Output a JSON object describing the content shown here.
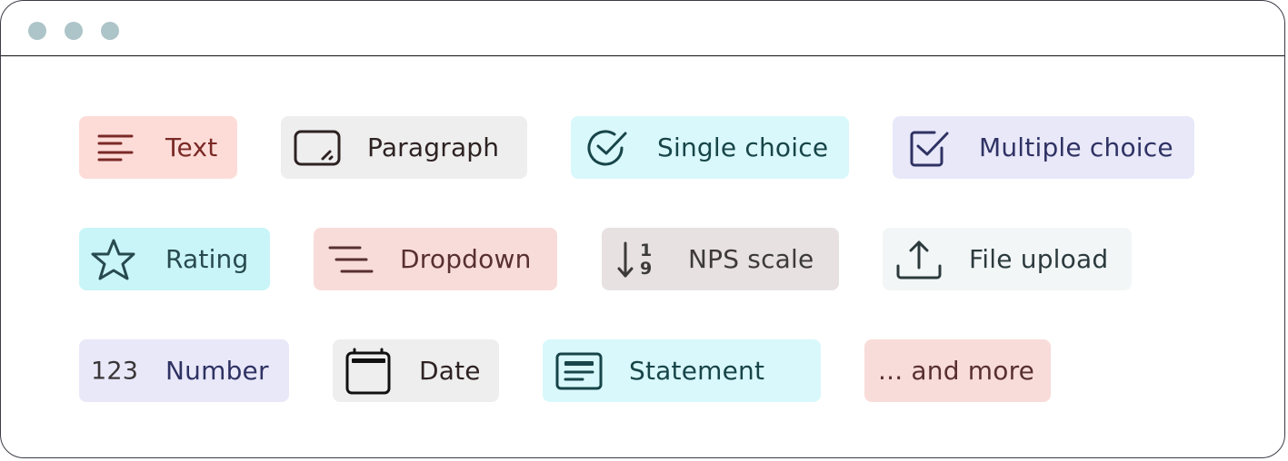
{
  "window": {
    "controls": [
      "dot-1",
      "dot-2",
      "dot-3"
    ],
    "control_color": "#adc4c8"
  },
  "field_types": [
    {
      "id": "text",
      "label": "Text",
      "icon": "text-lines-icon",
      "bg": "#fddcd8",
      "fg": "#7a2a26"
    },
    {
      "id": "paragraph",
      "label": "Paragraph",
      "icon": "paragraph-box-icon",
      "bg": "#eeeeee",
      "fg": "#2e2222"
    },
    {
      "id": "single-choice",
      "label": "Single choice",
      "icon": "circle-check-icon",
      "bg": "#d9f8fb",
      "fg": "#174549"
    },
    {
      "id": "multiple-choice",
      "label": "Multiple choice",
      "icon": "square-check-icon",
      "bg": "#e8e8f9",
      "fg": "#2f3263"
    },
    {
      "id": "rating",
      "label": "Rating",
      "icon": "star-icon",
      "bg": "#c9f5f8",
      "fg": "#284a4e"
    },
    {
      "id": "dropdown",
      "label": "Dropdown",
      "icon": "dropdown-lines-icon",
      "bg": "#f8dcd9",
      "fg": "#583031"
    },
    {
      "id": "nps-scale",
      "label": "NPS scale",
      "icon": "sort-numeric-icon",
      "icon_text_top": "1",
      "icon_text_bottom": "9",
      "bg": "#e7e1e1",
      "fg": "#3d3a3a"
    },
    {
      "id": "file-upload",
      "label": "File upload",
      "icon": "upload-icon",
      "bg": "#f2f6f7",
      "fg": "#2c3a3d"
    },
    {
      "id": "number",
      "label": "Number",
      "icon": "number-icon",
      "icon_text": "123",
      "bg": "#e8e8f9",
      "fg": "#2f3263"
    },
    {
      "id": "date",
      "label": "Date",
      "icon": "calendar-icon",
      "bg": "#eeeeee",
      "fg": "#2e2222"
    },
    {
      "id": "statement",
      "label": "Statement",
      "icon": "statement-card-icon",
      "bg": "#d9f8fb",
      "fg": "#174549"
    },
    {
      "id": "and-more",
      "label": "... and more",
      "icon": "",
      "bg": "#f8dcd9",
      "fg": "#583031"
    }
  ]
}
